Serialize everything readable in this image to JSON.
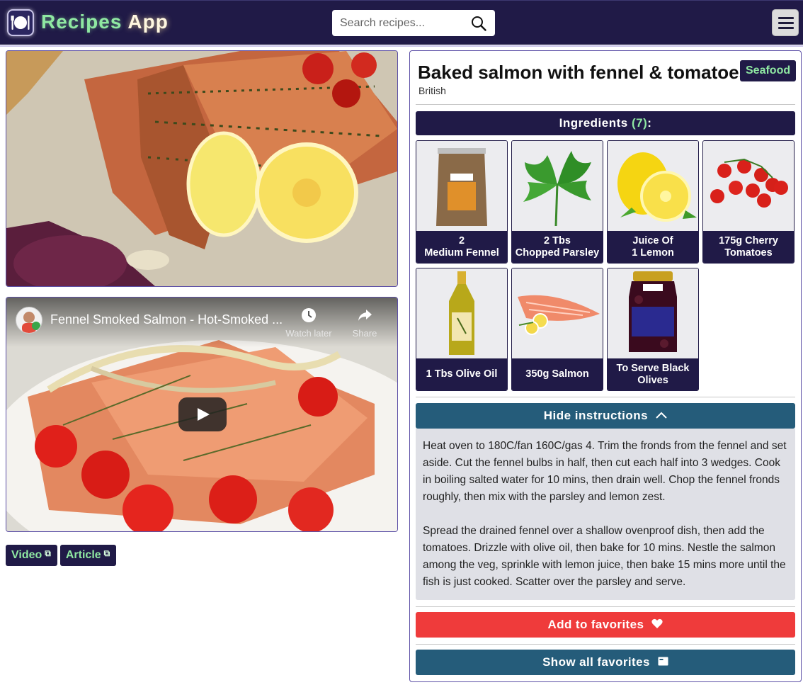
{
  "header": {
    "brand_part1": "Recipes",
    "brand_part2": "App",
    "search_placeholder": "Search recipes...",
    "icons": {
      "logo": "plate-cutlery-icon",
      "search": "search-icon",
      "menu": "hamburger-menu-icon"
    }
  },
  "video": {
    "title": "Fennel Smoked Salmon - Hot-Smoked ...",
    "watch_later_label": "Watch later",
    "share_label": "Share"
  },
  "sources": {
    "video_label": "Video",
    "article_label": "Article"
  },
  "meal": {
    "title": "Baked salmon with fennel & tomatoes",
    "area": "British",
    "category": "Seafood"
  },
  "ingredients": {
    "label": "Ingredients",
    "count": "(7)",
    "suffix": ":",
    "items": [
      {
        "caption": "2\nMedium Fennel",
        "image": "fennel-seeds-bag"
      },
      {
        "caption": "2 Tbs\nChopped Parsley",
        "image": "parsley"
      },
      {
        "caption": "Juice Of\n1 Lemon",
        "image": "lemon"
      },
      {
        "caption": "175g Cherry\nTomatoes",
        "image": "cherry-tomatoes"
      },
      {
        "caption": "1 Tbs Olive Oil",
        "image": "olive-oil-bottle"
      },
      {
        "caption": "350g Salmon",
        "image": "salmon-fillet"
      },
      {
        "caption": "To Serve Black\nOlives",
        "image": "black-olives-jar"
      }
    ]
  },
  "instructions": {
    "toggle_label": "Hide instructions",
    "paragraphs": [
      "Heat oven to 180C/fan 160C/gas 4. Trim the fronds from the fennel and set aside. Cut the fennel bulbs in half, then cut each half into 3 wedges. Cook in boiling salted water for 10 mins, then drain well. Chop the fennel fronds roughly, then mix with the parsley and lemon zest.",
      "Spread the drained fennel over a shallow ovenproof dish, then add the tomatoes. Drizzle with olive oil, then bake for 10 mins. Nestle the salmon among the veg, sprinkle with lemon juice, then bake 15 mins more until the fish is just cooked. Scatter over the parsley and serve."
    ]
  },
  "actions": {
    "add_favorite_label": "Add to favorites",
    "show_favorites_label": "Show all favorites"
  },
  "colors": {
    "navy": "#201a47",
    "accent_green": "#8fe8a2",
    "teal": "#255c7a",
    "red": "#ef3b3b"
  }
}
